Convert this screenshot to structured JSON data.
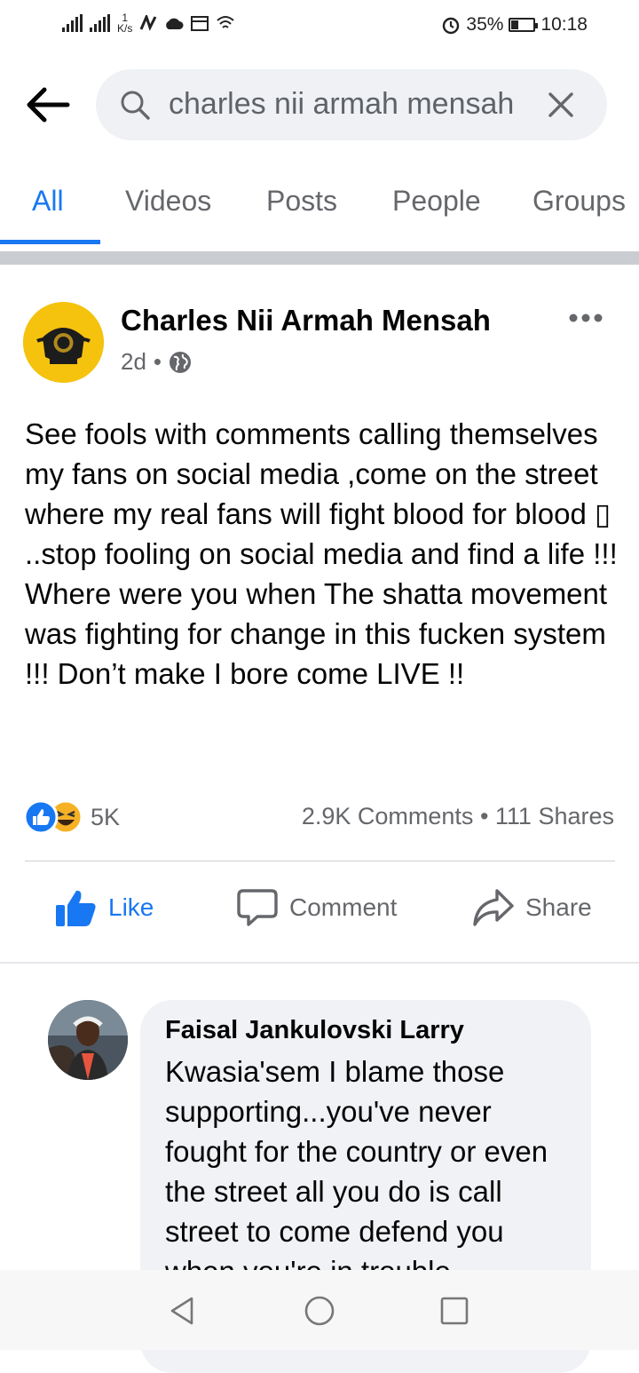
{
  "status_bar": {
    "speed_value": "1",
    "speed_unit": "K/s",
    "battery": "35%",
    "battery_level": 0.35,
    "time": "10:18"
  },
  "search": {
    "query": "charles nii armah mensah"
  },
  "tabs": [
    {
      "label": "All",
      "active": true
    },
    {
      "label": "Videos",
      "active": false
    },
    {
      "label": "Posts",
      "active": false
    },
    {
      "label": "People",
      "active": false
    },
    {
      "label": "Groups",
      "active": false
    }
  ],
  "post": {
    "author": "Charles Nii Armah Mensah",
    "time": "2d",
    "separator": "•",
    "text": "See fools with comments calling themselves my fans on social media ,come on the street where my real fans will fight blood for blood ▯ ..stop fooling on social media and find a life !!! Where were you when The shatta movement was fighting for change in this fucken system !!! Don’t make I bore come LIVE !!",
    "reaction_count": "5K",
    "comments_count": "2.9K Comments",
    "dot": "•",
    "shares_count": "111 Shares",
    "actions": {
      "like": "Like",
      "comment": "Comment",
      "share": "Share"
    }
  },
  "comment": {
    "author": "Faisal Jankulovski Larry",
    "text": "Kwasia'sem I blame those supporting...you've never fought for the country or even the street all you do is call street to come defend you when you're in trouble"
  },
  "colors": {
    "accent": "#1877f2",
    "avatar_bg": "#f5c20e",
    "haha": "#f7b125"
  }
}
